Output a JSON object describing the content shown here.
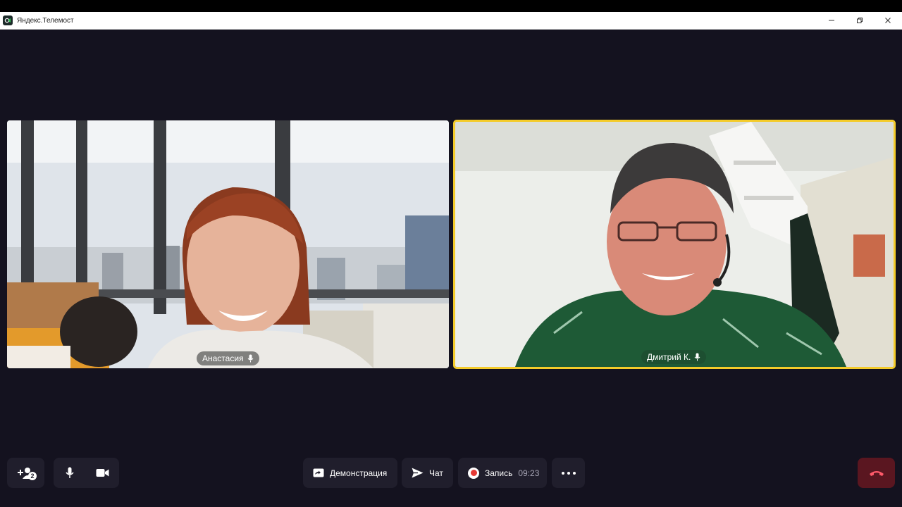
{
  "window": {
    "title": "Яндекс.Телемост",
    "icon": "telemost-app-icon"
  },
  "participants": [
    {
      "name": "Анастасия",
      "mic_icon": "microphone-icon",
      "active_speaker": false
    },
    {
      "name": "Дмитрий К.",
      "mic_icon": "microphone-icon",
      "active_speaker": true,
      "highlight_color": "#f4cb2a"
    }
  ],
  "toolbar": {
    "invite_icon": "add-participant-icon",
    "invite_badge": "2",
    "mic_icon": "microphone-icon",
    "camera_icon": "camera-icon",
    "demo_label": "Демонстрация",
    "demo_icon": "screen-share-icon",
    "chat_label": "Чат",
    "chat_icon": "send-icon",
    "record_label": "Запись",
    "record_time": "09:23",
    "record_icon": "record-icon",
    "more_icon": "more-icon",
    "hangup_icon": "hang-up-icon",
    "hangup_color": "#5a1620"
  },
  "colors": {
    "stage_background": "#14121f",
    "button_background": "#201e2c",
    "active_speaker_border": "#f4cb2a",
    "record_red": "#e53935"
  }
}
